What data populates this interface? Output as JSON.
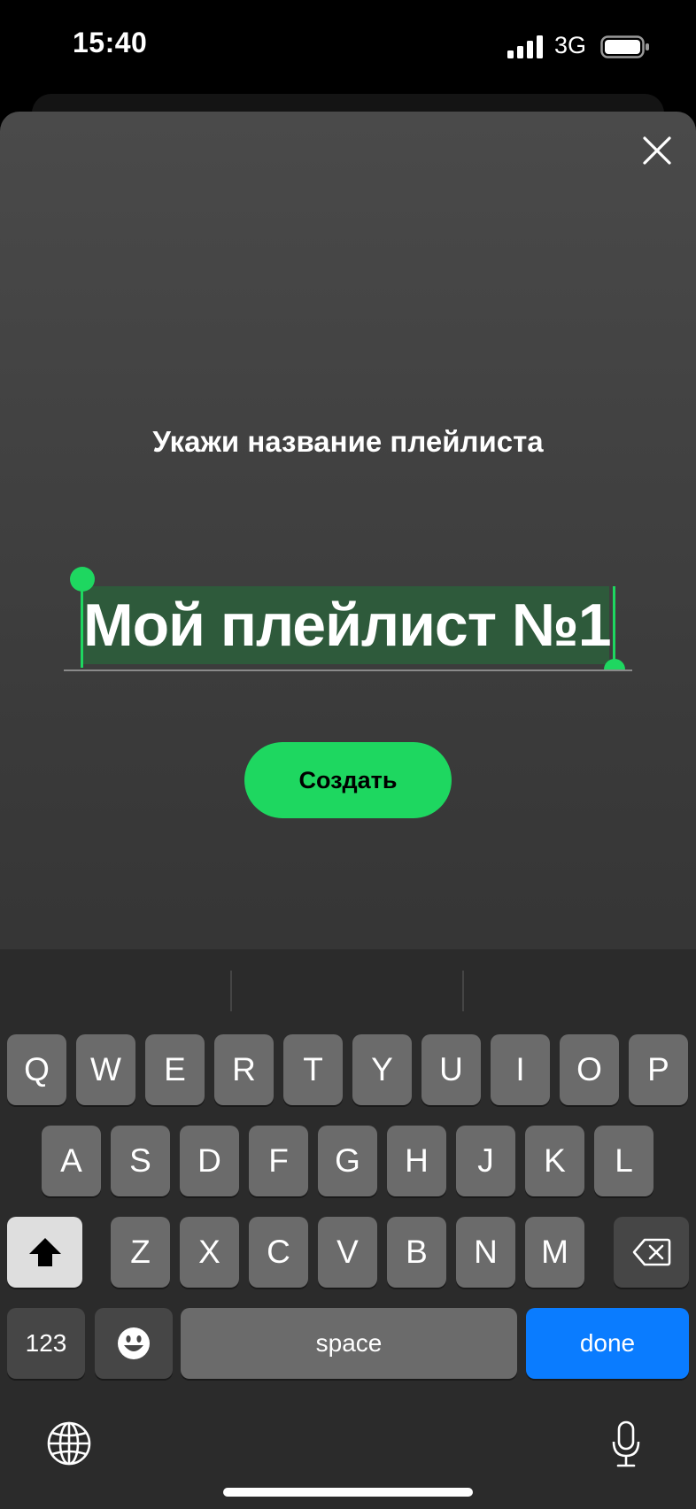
{
  "status_bar": {
    "time": "15:40",
    "network": "3G"
  },
  "dialog": {
    "prompt": "Укажи название плейлиста",
    "playlist_name": "Мой плейлист №1",
    "create_label": "Создать"
  },
  "keyboard": {
    "row1": [
      "Q",
      "W",
      "E",
      "R",
      "T",
      "Y",
      "U",
      "I",
      "O",
      "P"
    ],
    "row2": [
      "A",
      "S",
      "D",
      "F",
      "G",
      "H",
      "J",
      "K",
      "L"
    ],
    "row3": [
      "Z",
      "X",
      "C",
      "V",
      "B",
      "N",
      "M"
    ],
    "numbers_label": "123",
    "space_label": "space",
    "done_label": "done"
  },
  "colors": {
    "accent": "#1ed760",
    "done": "#0a7cff",
    "selection": "#2e5a3b"
  }
}
